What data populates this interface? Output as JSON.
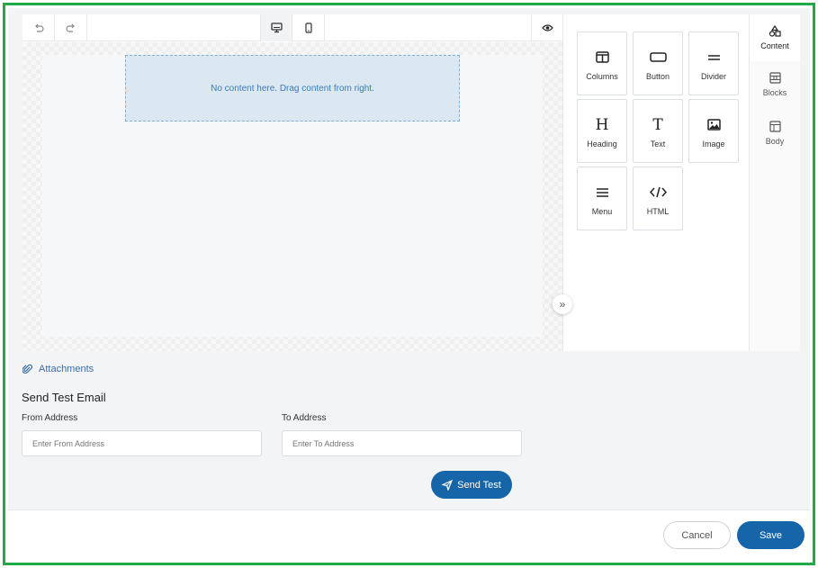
{
  "toolbar": {
    "undo_icon": "undo-icon",
    "redo_icon": "redo-icon",
    "desktop_icon": "desktop-icon",
    "mobile_icon": "mobile-icon",
    "preview_icon": "eye-icon"
  },
  "canvas": {
    "dropzone_text": "No content here. Drag content from right."
  },
  "content_tiles": [
    {
      "label": "Columns",
      "icon": "columns-icon"
    },
    {
      "label": "Button",
      "icon": "button-icon"
    },
    {
      "label": "Divider",
      "icon": "divider-icon"
    },
    {
      "label": "Heading",
      "icon": "heading-icon"
    },
    {
      "label": "Text",
      "icon": "text-icon"
    },
    {
      "label": "Image",
      "icon": "image-icon"
    },
    {
      "label": "Menu",
      "icon": "menu-icon"
    },
    {
      "label": "HTML",
      "icon": "code-icon"
    }
  ],
  "side_tabs": [
    {
      "label": "Content",
      "icon": "shapes-icon",
      "active": true
    },
    {
      "label": "Blocks",
      "icon": "blocks-icon",
      "active": false
    },
    {
      "label": "Body",
      "icon": "layout-icon",
      "active": false
    }
  ],
  "attachments": {
    "label": "Attachments",
    "icon": "paperclip-icon"
  },
  "send_test": {
    "title": "Send Test Email",
    "from_label": "From Address",
    "from_placeholder": "Enter From Address",
    "from_value": "",
    "to_label": "To Address",
    "to_placeholder": "Enter To Address",
    "to_value": "",
    "button_label": "Send Test",
    "button_icon": "send-icon"
  },
  "footer": {
    "cancel_label": "Cancel",
    "save_label": "Save"
  },
  "colors": {
    "frame_border": "#1faa4a",
    "primary": "#1565a8",
    "link": "#3a6ea5",
    "dropzone_bg": "#dbe8f2"
  }
}
